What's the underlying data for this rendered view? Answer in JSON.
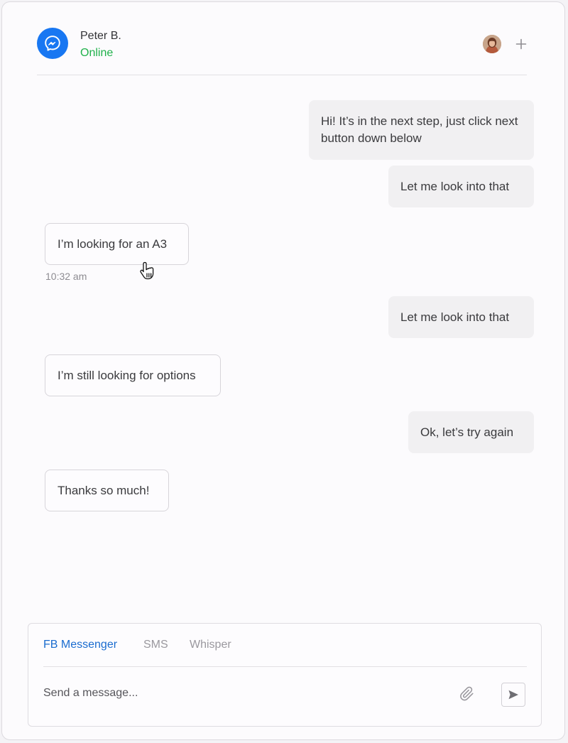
{
  "header": {
    "contact_name": "Peter B.",
    "status": "Online",
    "channel_icon": "messenger-icon",
    "add_icon": "plus-icon"
  },
  "messages": [
    {
      "direction": "outgoing",
      "text": "Hi! It’s in the next step, just click next button down below"
    },
    {
      "direction": "outgoing",
      "text": "Let me look into that"
    },
    {
      "direction": "incoming",
      "text": "I’m looking for an A3",
      "timestamp": "10:32 am"
    },
    {
      "direction": "outgoing",
      "text": "Let me look into that"
    },
    {
      "direction": "incoming",
      "text": "I’m still looking for options"
    },
    {
      "direction": "outgoing",
      "text": "Ok, let’s try again"
    },
    {
      "direction": "incoming",
      "text": "Thanks so much!"
    }
  ],
  "composer": {
    "tabs": [
      {
        "label": "FB Messenger",
        "active": true
      },
      {
        "label": "SMS",
        "active": false
      },
      {
        "label": "Whisper",
        "active": false
      }
    ],
    "placeholder": "Send a message...",
    "attach_icon": "paperclip-icon",
    "send_icon": "send-icon"
  },
  "colors": {
    "online": "#1fb14a",
    "messenger_blue": "#1877f2",
    "active_tab": "#1a6ccf"
  }
}
